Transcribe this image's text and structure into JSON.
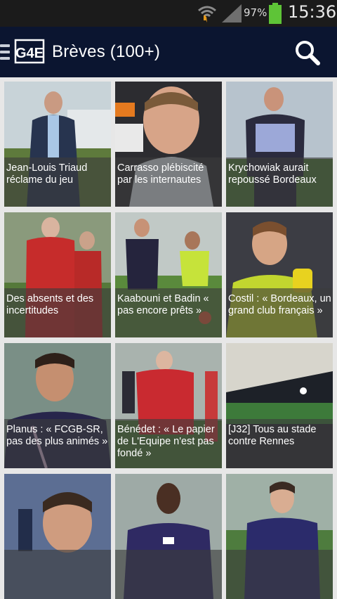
{
  "status_bar": {
    "battery_percent": "97%",
    "time": "15:36",
    "icons": [
      "wifi-icon",
      "signal-icon",
      "battery-icon"
    ]
  },
  "action_bar": {
    "logo_text": "G4E",
    "title": "Brèves (100+)",
    "background": "#0b1530"
  },
  "tiles": [
    {
      "caption": "Jean-Louis Triaud réclame du jeu"
    },
    {
      "caption": "Carrasso plébiscité par les internautes"
    },
    {
      "caption": "Krychowiak aurait repoussé Bordeaux"
    },
    {
      "caption": "Des absents et des incertitudes"
    },
    {
      "caption": "Kaabouni et Badin « pas encore prêts »"
    },
    {
      "caption": "Costil : « Bordeaux, un grand club français »"
    },
    {
      "caption": "Planus : « FCGB-SR, pas des plus animés »"
    },
    {
      "caption": "Bénédet : « Le papier de L'Equipe n'est pas fondé »"
    },
    {
      "caption": "[J32] Tous au stade contre Rennes"
    },
    {
      "caption": ""
    },
    {
      "caption": ""
    },
    {
      "caption": ""
    }
  ]
}
